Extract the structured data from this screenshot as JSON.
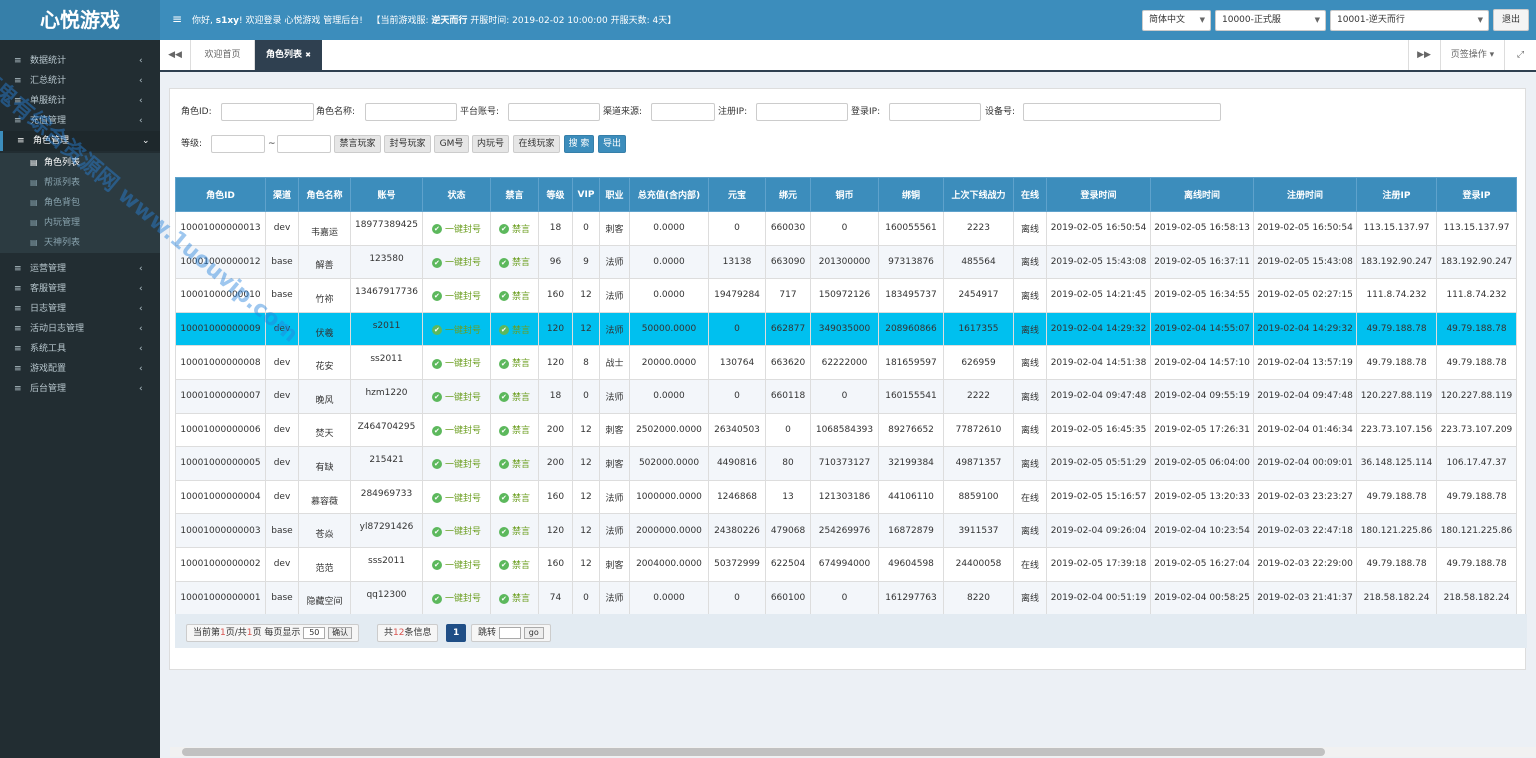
{
  "header": {
    "logo": "心悦游戏",
    "toggle": "≡",
    "greeting": "你好,",
    "user": "s1xy",
    "welcome_mid": "! 欢迎登录 心悦游戏 管理后台!",
    "server_label": "【当前游戏服:",
    "server_name": "逆天而行",
    "open_time": "开服时间: 2019-02-02 10:00:00 开服天数: 4天】",
    "lang": "简体中文",
    "channel": "10000-正式服",
    "server_select": "10001-逆天而行",
    "logout": "退出"
  },
  "sidebar": {
    "items": [
      {
        "label": "数据统计",
        "icon": "≡",
        "chev": "‹"
      },
      {
        "label": "汇总统计",
        "icon": "≡",
        "chev": "‹"
      },
      {
        "label": "单服统计",
        "icon": "≡",
        "chev": "‹"
      },
      {
        "label": "充值管理",
        "icon": "≡",
        "chev": "‹"
      },
      {
        "label": "角色管理",
        "icon": "≡",
        "chev": "⌄"
      },
      {
        "label": "运营管理",
        "icon": "≡",
        "chev": "‹"
      },
      {
        "label": "客服管理",
        "icon": "≡",
        "chev": "‹"
      },
      {
        "label": "日志管理",
        "icon": "≡",
        "chev": "‹"
      },
      {
        "label": "活动日志管理",
        "icon": "≡",
        "chev": "‹"
      },
      {
        "label": "系统工具",
        "icon": "≡",
        "chev": "‹"
      },
      {
        "label": "游戏配置",
        "icon": "≡",
        "chev": "‹"
      },
      {
        "label": "后台管理",
        "icon": "≡",
        "chev": "‹"
      }
    ],
    "subitems": [
      {
        "label": "角色列表"
      },
      {
        "label": "帮派列表"
      },
      {
        "label": "角色背包"
      },
      {
        "label": "内玩管理"
      },
      {
        "label": "天神列表"
      }
    ]
  },
  "tabs": {
    "back": "◀◀",
    "home": "欢迎首页",
    "active": "角色列表",
    "close": "✖",
    "fwd": "▶▶",
    "ops": "页签操作 ▾",
    "full": "⤢"
  },
  "search": {
    "role_id": "角色ID:",
    "role_name": "角色名称:",
    "platform": "平台账号:",
    "channel": "渠道来源:",
    "reg_ip": "注册IP:",
    "login_ip": "登录IP:",
    "device": "设备号:",
    "level": "等级:",
    "tilde": "~",
    "buttons": [
      "禁言玩家",
      "封号玩家",
      "GM号",
      "内玩号",
      "在线玩家"
    ],
    "search": "搜 索",
    "export": "导出"
  },
  "table": {
    "headers": [
      "角色ID",
      "渠道",
      "角色名称",
      "账号",
      "状态",
      "禁言",
      "等级",
      "VIP",
      "职业",
      "总充值(含内部)",
      "元宝",
      "绑元",
      "铜币",
      "绑铜",
      "上次下线战力",
      "在线",
      "登录时间",
      "离线时间",
      "注册时间",
      "注册IP",
      "登录IP"
    ],
    "ban_label": "一键封号",
    "mute_label": "禁言",
    "check": "✔",
    "rows": [
      {
        "id": "10001000000013",
        "ch": "dev",
        "name": "韦嘉运",
        "acct": "18977389425",
        "lv": "18",
        "vip": "0",
        "job": "刺客",
        "pay": "0.0000",
        "yb": "0",
        "by": "660030",
        "tb": "0",
        "bt": "160055561",
        "pow": "2223",
        "on": "离线",
        "login": "2019-02-05 16:50:54",
        "off": "2019-02-05 16:58:13",
        "reg": "2019-02-05 16:50:54",
        "rip": "113.15.137.97",
        "lip": "113.15.137.97"
      },
      {
        "id": "10001000000012",
        "ch": "base",
        "name": "解善",
        "acct": "123580",
        "lv": "96",
        "vip": "9",
        "job": "法师",
        "pay": "0.0000",
        "yb": "13138",
        "by": "663090",
        "tb": "201300000",
        "bt": "97313876",
        "pow": "485564",
        "on": "离线",
        "login": "2019-02-05 15:43:08",
        "off": "2019-02-05 16:37:11",
        "reg": "2019-02-05 15:43:08",
        "rip": "183.192.90.247",
        "lip": "183.192.90.247"
      },
      {
        "id": "10001000000010",
        "ch": "base",
        "name": "竹祢",
        "acct": "13467917736",
        "lv": "160",
        "vip": "12",
        "job": "法师",
        "pay": "0.0000",
        "yb": "19479284",
        "by": "717",
        "tb": "150972126",
        "bt": "183495737",
        "pow": "2454917",
        "on": "离线",
        "login": "2019-02-05 14:21:45",
        "off": "2019-02-05 16:34:55",
        "reg": "2019-02-05 02:27:15",
        "rip": "111.8.74.232",
        "lip": "111.8.74.232"
      },
      {
        "id": "10001000000009",
        "ch": "dev",
        "name": "伏羲",
        "acct": "s2011",
        "lv": "120",
        "vip": "12",
        "job": "法师",
        "pay": "50000.0000",
        "yb": "0",
        "by": "662877",
        "tb": "349035000",
        "bt": "208960866",
        "pow": "1617355",
        "on": "离线",
        "login": "2019-02-04 14:29:32",
        "off": "2019-02-04 14:55:07",
        "reg": "2019-02-04 14:29:32",
        "rip": "49.79.188.78",
        "lip": "49.79.188.78"
      },
      {
        "id": "10001000000008",
        "ch": "dev",
        "name": "花安",
        "acct": "ss2011",
        "lv": "120",
        "vip": "8",
        "job": "战士",
        "pay": "20000.0000",
        "yb": "130764",
        "by": "663620",
        "tb": "62222000",
        "bt": "181659597",
        "pow": "626959",
        "on": "离线",
        "login": "2019-02-04 14:51:38",
        "off": "2019-02-04 14:57:10",
        "reg": "2019-02-04 13:57:19",
        "rip": "49.79.188.78",
        "lip": "49.79.188.78"
      },
      {
        "id": "10001000000007",
        "ch": "dev",
        "name": "晚风",
        "acct": "hzm1220",
        "lv": "18",
        "vip": "0",
        "job": "法师",
        "pay": "0.0000",
        "yb": "0",
        "by": "660118",
        "tb": "0",
        "bt": "160155541",
        "pow": "2222",
        "on": "离线",
        "login": "2019-02-04 09:47:48",
        "off": "2019-02-04 09:55:19",
        "reg": "2019-02-04 09:47:48",
        "rip": "120.227.88.119",
        "lip": "120.227.88.119"
      },
      {
        "id": "10001000000006",
        "ch": "dev",
        "name": "焚天",
        "acct": "Z464704295",
        "lv": "200",
        "vip": "12",
        "job": "刺客",
        "pay": "2502000.0000",
        "yb": "26340503",
        "by": "0",
        "tb": "1068584393",
        "bt": "89276652",
        "pow": "77872610",
        "on": "离线",
        "login": "2019-02-05 16:45:35",
        "off": "2019-02-05 17:26:31",
        "reg": "2019-02-04 01:46:34",
        "rip": "223.73.107.156",
        "lip": "223.73.107.209"
      },
      {
        "id": "10001000000005",
        "ch": "dev",
        "name": "有缺",
        "acct": "215421",
        "lv": "200",
        "vip": "12",
        "job": "刺客",
        "pay": "502000.0000",
        "yb": "4490816",
        "by": "80",
        "tb": "710373127",
        "bt": "32199384",
        "pow": "49871357",
        "on": "离线",
        "login": "2019-02-05 05:51:29",
        "off": "2019-02-05 06:04:00",
        "reg": "2019-02-04 00:09:01",
        "rip": "36.148.125.114",
        "lip": "106.17.47.37"
      },
      {
        "id": "10001000000004",
        "ch": "dev",
        "name": "慕容薇",
        "acct": "284969733",
        "lv": "160",
        "vip": "12",
        "job": "法师",
        "pay": "1000000.0000",
        "yb": "1246868",
        "by": "13",
        "tb": "121303186",
        "bt": "44106110",
        "pow": "8859100",
        "on": "在线",
        "login": "2019-02-05 15:16:57",
        "off": "2019-02-05 13:20:33",
        "reg": "2019-02-03 23:23:27",
        "rip": "49.79.188.78",
        "lip": "49.79.188.78"
      },
      {
        "id": "10001000000003",
        "ch": "base",
        "name": "苍焱",
        "acct": "yl87291426",
        "lv": "120",
        "vip": "12",
        "job": "法师",
        "pay": "2000000.0000",
        "yb": "24380226",
        "by": "479068",
        "tb": "254269976",
        "bt": "16872879",
        "pow": "3911537",
        "on": "离线",
        "login": "2019-02-04 09:26:04",
        "off": "2019-02-04 10:23:54",
        "reg": "2019-02-03 22:47:18",
        "rip": "180.121.225.86",
        "lip": "180.121.225.86"
      },
      {
        "id": "10001000000002",
        "ch": "dev",
        "name": "范范",
        "acct": "sss2011",
        "lv": "160",
        "vip": "12",
        "job": "刺客",
        "pay": "2004000.0000",
        "yb": "50372999",
        "by": "622504",
        "tb": "674994000",
        "bt": "49604598",
        "pow": "24400058",
        "on": "在线",
        "login": "2019-02-05 17:39:18",
        "off": "2019-02-05 16:27:04",
        "reg": "2019-02-03 22:29:00",
        "rip": "49.79.188.78",
        "lip": "49.79.188.78"
      },
      {
        "id": "10001000000001",
        "ch": "base",
        "name": "隐藏空间",
        "acct": "qq12300",
        "lv": "74",
        "vip": "0",
        "job": "法师",
        "pay": "0.0000",
        "yb": "0",
        "by": "660100",
        "tb": "0",
        "bt": "161297763",
        "pow": "8220",
        "on": "离线",
        "login": "2019-02-04 00:51:19",
        "off": "2019-02-04 00:58:25",
        "reg": "2019-02-03 21:41:37",
        "rip": "218.58.182.24",
        "lip": "218.58.182.24"
      }
    ]
  },
  "pager": {
    "pre": "当前第",
    "page": "1",
    "mid": "页/共",
    "total_pages": "1",
    "post": "页 每页显示",
    "page_size": "50",
    "confirm": "确认",
    "count_pre": "共",
    "count": "12",
    "count_post": "条信息",
    "current": "1",
    "jump": "跳转",
    "go": "go"
  },
  "watermark": "壹鬼有综合资源网 www.1uouvip.com"
}
